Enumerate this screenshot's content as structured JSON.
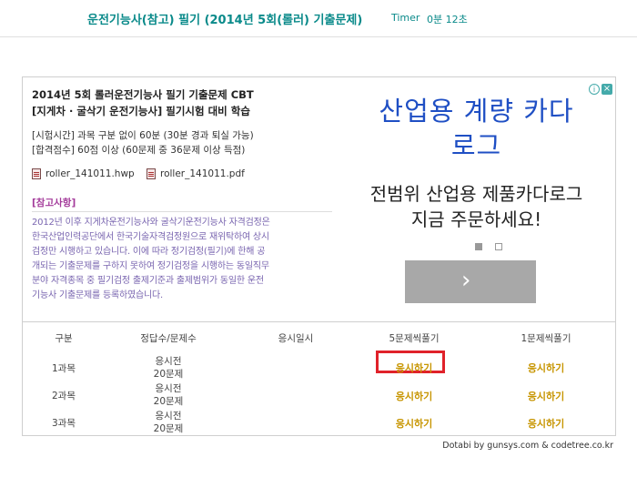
{
  "header": {
    "title": "운전기능사(참고) 필기 (2014년 5회(롤러) 기출문제)",
    "timer_label": "Timer",
    "timer_value": "0분 12초"
  },
  "info": {
    "title_line1": "2014년 5회 롤러운전기능사 필기 기출문제 CBT",
    "title_line2": "[지게차 · 굴삭기 운전기능사] 필기시험 대비 학습",
    "time_line": "[시험시간] 과목 구분 없이 60분 (30분 경과 퇴실 가능)",
    "pass_line": "[합격점수] 60점 이상 (60문제 중 36문제 이상 득점)",
    "file_hwp": "roller_141011.hwp",
    "file_pdf": "roller_141011.pdf",
    "notice_title": "[참고사항]",
    "notice_lines": [
      "2012년 이후 지게차운전기능사와 굴삭기운전기능사 자격검정은",
      "한국산업인력공단에서 한국기술자격검정원으로 재위탁하여 상시",
      "검정만 시행하고 있습니다. 이에 따라 정기검정(필기)에 한해 공",
      "개되는 기출문제를 구하지 못하여 정기검정을 시행하는 동일직무",
      "분야 자격종목 중 필기검정 출제기준과 출제범위가 동일한 운전",
      "기능사 기출문제를 등록하였습니다."
    ]
  },
  "ad": {
    "headline_line1": "산업용 계량 카다",
    "headline_line2": "로그",
    "sub_line1": "전범위 산업용 제품카다로그",
    "sub_line2": "지금 주문하세요!",
    "info_icon": "i",
    "close_icon": "×",
    "arrow": "›"
  },
  "table": {
    "headers": [
      "구분",
      "정답수/문제수",
      "응시일시",
      "5문제씩풀기",
      "1문제씩풀기"
    ],
    "rows": [
      {
        "subject": "1과목",
        "status_line1": "응시전",
        "status_line2": "20문제",
        "date": "",
        "go5": "응시하기",
        "go1": "응시하기"
      },
      {
        "subject": "2과목",
        "status_line1": "응시전",
        "status_line2": "20문제",
        "date": "",
        "go5": "응시하기",
        "go1": "응시하기"
      },
      {
        "subject": "3과목",
        "status_line1": "응시전",
        "status_line2": "20문제",
        "date": "",
        "go5": "응시하기",
        "go1": "응시하기"
      }
    ]
  },
  "footer": {
    "credit": "Dotabi by gunsys.com & codetree.co.kr"
  },
  "colors": {
    "accent": "#0a8a8a",
    "notice": "#a33a9a",
    "ad_headline": "#1f4fc4",
    "go_button": "#c79500",
    "highlight": "#e0222a"
  },
  "icons": {
    "file_hwp": "document-icon",
    "file_pdf": "pdf-icon",
    "ad_next": "chevron-right-icon"
  }
}
